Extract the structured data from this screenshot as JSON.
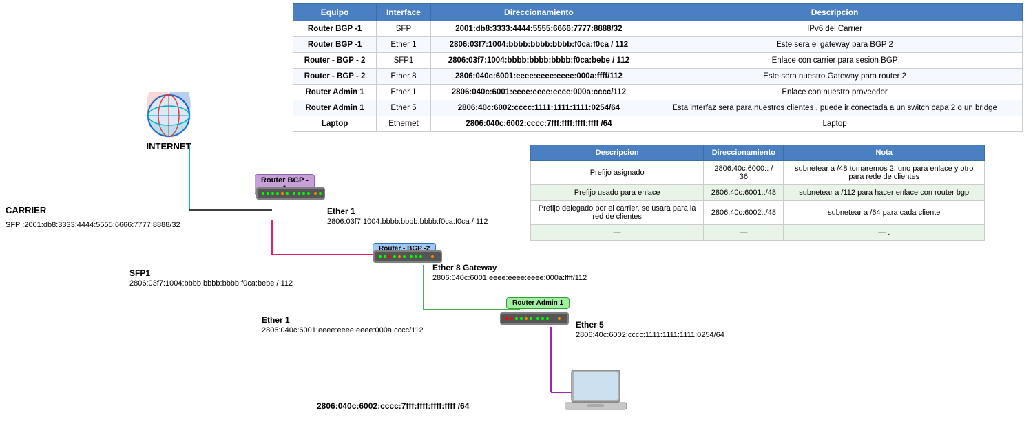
{
  "table": {
    "headers": [
      "Equipo",
      "Interface",
      "Direccionamiento",
      "Descripcion"
    ],
    "rows": [
      {
        "equipo": "Router BGP -1",
        "interface": "SFP",
        "direccionamiento": "2001:db8:3333:4444:5555:6666:7777:8888/32",
        "descripcion": "IPv6 del Carrier"
      },
      {
        "equipo": "Router BGP -1",
        "interface": "Ether 1",
        "direccionamiento": "2806:03f7:1004:bbbb:bbbb:bbbb:f0ca:f0ca / 112",
        "descripcion": "Este sera el gateway para BGP 2"
      },
      {
        "equipo": "Router - BGP - 2",
        "interface": "SFP1",
        "direccionamiento": "2806:03f7:1004:bbbb:bbbb:bbbb:f0ca:bebe / 112",
        "descripcion": "Enlace con carrier para sesion BGP"
      },
      {
        "equipo": "Router - BGP - 2",
        "interface": "Ether 8",
        "direccionamiento": "2806:040c:6001:eeee:eeee:eeee:000a:ffff/112",
        "descripcion": "Este sera nuestro Gateway para router 2"
      },
      {
        "equipo": "Router Admin 1",
        "interface": "Ether 1",
        "direccionamiento": "2806:040c:6001:eeee:eeee:eeee:000a:cccc/112",
        "descripcion": "Enlace con nuestro proveedor"
      },
      {
        "equipo": "Router Admin 1",
        "interface": "Ether 5",
        "direccionamiento": "2806:40c:6002:cccc:1111:1111:1111:0254/64",
        "descripcion": "Esta interfaz sera para nuestros clientes , puede ir conectada a un switch capa 2 o un bridge"
      },
      {
        "equipo": "Laptop",
        "interface": "Ethernet",
        "direccionamiento": "2806:040c:6002:cccc:7fff:ffff:ffff:ffff /64",
        "descripcion": "Laptop"
      }
    ]
  },
  "sec_table": {
    "headers": [
      "Descripcion",
      "Direccionamiento",
      "Nota"
    ],
    "rows": [
      {
        "desc": "Prefijo asignado",
        "dir": "2806:40c:6000:: / 36",
        "nota": "subnetear a /48  tomaremos 2, uno para enlace y otro para rede de clientes"
      },
      {
        "desc": "Prefijo usado para enlace",
        "dir": "2806:40c:6001::/48",
        "nota": "subnetear a /112 para hacer enlace con router bgp"
      },
      {
        "desc": "Prefijo delegado por el carrier, se usara para la red de clientes",
        "dir": "2806:40c:6002::/48",
        "nota": "subnetear a /64 para cada cliente"
      },
      {
        "desc": "—",
        "dir": "—",
        "nota": "—  ."
      }
    ]
  },
  "diagram": {
    "internet_label": "INTERNET",
    "carrier_label": "CARRIER",
    "carrier_sfp": "SFP :2001:db8:3333:4444:5555:6666:7777:8888/32",
    "router_bgp1_label": "Router BGP -\n1",
    "router_bgp1_ether1": "Ether 1",
    "router_bgp1_addr1": "2806:03f7:1004:bbbb:bbbb:bbbb:f0ca:f0ca / 112",
    "router_bgp2_label": "Router - BGP -2",
    "router_bgp2_sfp1": "SFP1",
    "router_bgp2_sfp1_addr": "2806:03f7:1004:bbbb:bbbb:bbbb:f0ca:bebe / 112",
    "router_bgp2_ether8": "Ether 8 Gateway",
    "router_bgp2_ether8_addr": "2806:040c:6001:eeee:eeee:eeee:000a:ffff/112",
    "router_admin1_label": "Router Admin 1",
    "router_admin1_ether1": "Ether 1",
    "router_admin1_ether1_addr": "2806:040c:6001:eeee:eeee:eeee:000a:cccc/112",
    "router_admin1_ether5": "Ether 5",
    "router_admin1_ether5_addr": "2806:40c:6002:cccc:1111:1111:1111:0254/64",
    "laptop_addr": "2806:040c:6002:cccc:7fff:ffff:ffff:ffff /64"
  }
}
